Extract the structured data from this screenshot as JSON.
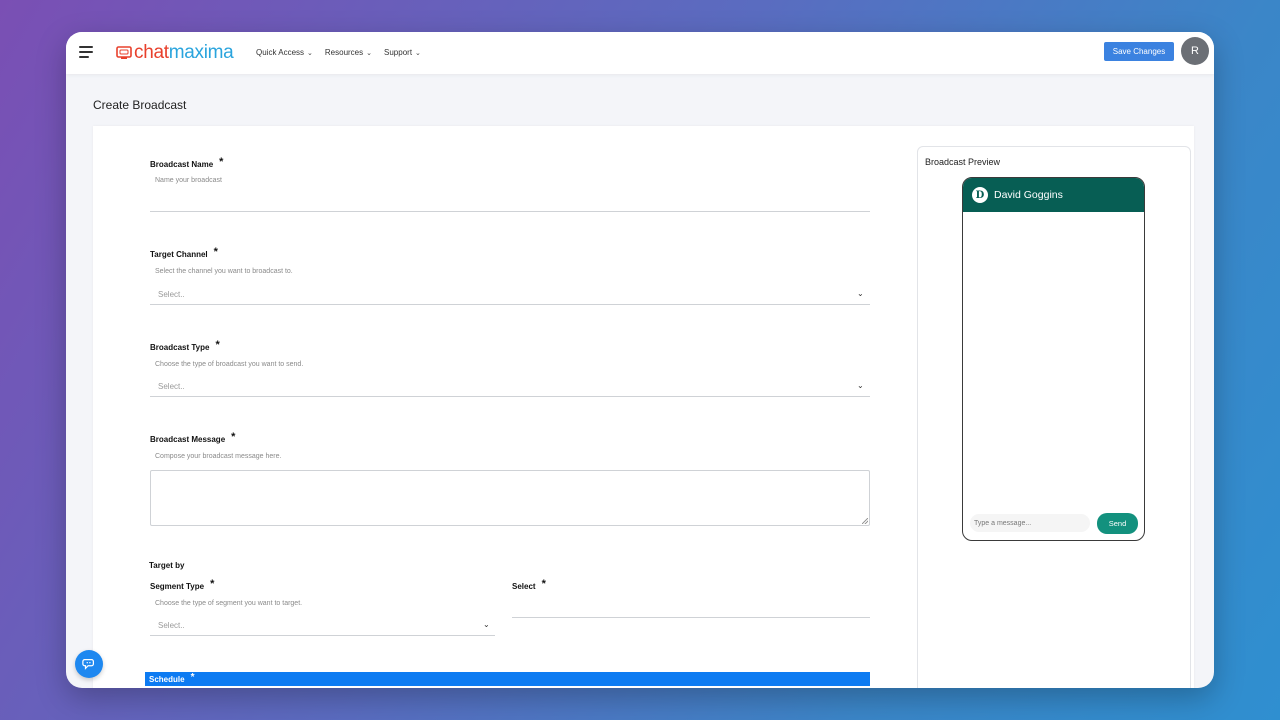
{
  "brand": {
    "chat": "chat",
    "maxima": "maxima"
  },
  "nav": {
    "items": [
      {
        "label": "Quick Access"
      },
      {
        "label": "Resources"
      },
      {
        "label": "Support"
      }
    ]
  },
  "header": {
    "save_label": "Save Changes",
    "avatar_initial": "R"
  },
  "page": {
    "title": "Create Broadcast"
  },
  "form": {
    "broadcast_name": {
      "label": "Broadcast Name",
      "required": "*",
      "hint": "Name your broadcast"
    },
    "target_channel": {
      "label": "Target Channel",
      "required": "*",
      "hint": "Select the channel you want to broadcast to.",
      "placeholder": "Select.."
    },
    "broadcast_type": {
      "label": "Broadcast Type",
      "required": "*",
      "hint": "Choose the type of broadcast you want to send.",
      "placeholder": "Select.."
    },
    "broadcast_message": {
      "label": "Broadcast Message",
      "required": "*",
      "hint": "Compose your broadcast message here."
    },
    "target_by": {
      "label": "Target by"
    },
    "segment_type": {
      "label": "Segment Type",
      "required": "*",
      "hint": "Choose the type of segment you want to target.",
      "placeholder": "Select.."
    },
    "select": {
      "label": "Select",
      "required": "*"
    },
    "schedule": {
      "label": "Schedule",
      "required": "*"
    }
  },
  "preview": {
    "title": "Broadcast Preview",
    "contact_initial": "D",
    "contact_name": "David Goggins",
    "input_placeholder": "Type a message...",
    "send_label": "Send"
  },
  "colors": {
    "accent": "#3b82e0",
    "whatsapp_header": "#075e54",
    "send_button": "#13917e",
    "schedule_bar": "#0d7bf2",
    "logo_red": "#e8402c",
    "logo_blue": "#2aa4dd"
  },
  "icons": {
    "menu": "hamburger-menu-icon",
    "chevron": "chevron-down-icon",
    "chat_support": "chat-bubble-icon"
  }
}
